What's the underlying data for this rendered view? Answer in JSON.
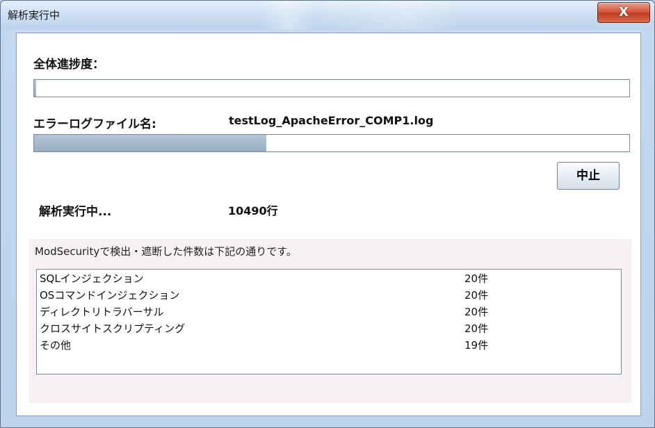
{
  "window": {
    "title": "解析実行中",
    "close_label": "X"
  },
  "overall": {
    "label": "全体進捗度：",
    "progress": 0.003
  },
  "file": {
    "label": "エラーログファイル名:",
    "name": "testLog_ApacheError_COMP1.log",
    "progress": 0.39
  },
  "stop_button": {
    "label": "中止"
  },
  "status": {
    "label": "解析実行中...",
    "line_count": "10490行"
  },
  "results": {
    "caption": "ModSecurityで検出・遮断した件数は下記の通りです。",
    "items": [
      {
        "name": "SQLインジェクション",
        "count": "20件"
      },
      {
        "name": "OSコマンドインジェクション",
        "count": "20件"
      },
      {
        "name": "ディレクトリトラバーサル",
        "count": "20件"
      },
      {
        "name": "クロスサイトスクリプティング",
        "count": "20件"
      },
      {
        "name": "その他",
        "count": "19件"
      }
    ]
  }
}
